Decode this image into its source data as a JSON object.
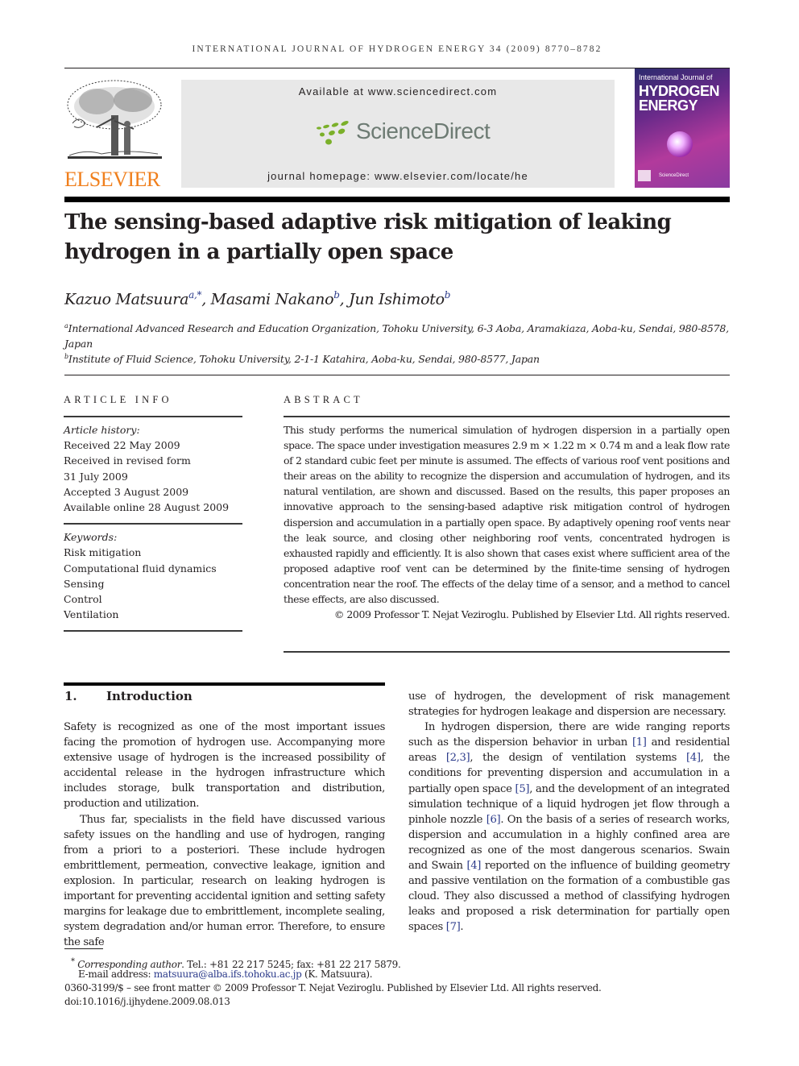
{
  "header": {
    "running_head": "INTERNATIONAL JOURNAL OF HYDROGEN ENERGY 34 (2009) 8770–8782",
    "publisher_word": "ELSEVIER",
    "available_at": "Available at www.sciencedirect.com",
    "sciencedirect_logo": "ScienceDirect",
    "journal_homepage": "journal homepage: www.elsevier.com/locate/he",
    "cover": {
      "line1": "International Journal of",
      "line2": "HYDROGEN",
      "line3": "ENERGY",
      "footer": "ScienceDirect"
    },
    "colors": {
      "elsevier_orange": "#f07f1c",
      "sd_green": "#7bb02a",
      "sd_gray": "#6d7b73",
      "link_blue": "#2b3a8a"
    }
  },
  "article": {
    "title_line1": "The sensing-based adaptive risk mitigation of leaking",
    "title_line2": "hydrogen in a partially open space",
    "authors": [
      {
        "name": "Kazuo Matsuura",
        "sup": "a,*"
      },
      {
        "name": "Masami Nakano",
        "sup": "b"
      },
      {
        "name": "Jun Ishimoto",
        "sup": "b"
      }
    ],
    "sep": ", ",
    "affiliations": [
      {
        "mark": "a",
        "text": "International Advanced Research and Education Organization, Tohoku University, 6-3 Aoba, Aramakiaza, Aoba-ku, Sendai, 980-8578,",
        "text2": "Japan"
      },
      {
        "mark": "b",
        "text": "Institute of Fluid Science, Tohoku University, 2-1-1 Katahira, Aoba-ku, Sendai, 980-8577, Japan"
      }
    ]
  },
  "article_info": {
    "heading": "ARTICLE INFO",
    "history_label": "Article history:",
    "history": [
      "Received 22 May 2009",
      "Received in revised form",
      "31 July 2009",
      "Accepted 3 August 2009",
      "Available online 28 August 2009"
    ],
    "keywords_label": "Keywords:",
    "keywords": [
      "Risk mitigation",
      "Computational fluid dynamics",
      "Sensing",
      "Control",
      "Ventilation"
    ]
  },
  "abstract": {
    "heading": "ABSTRACT",
    "text": "This study performs the numerical simulation of hydrogen dispersion in a partially open space. The space under investigation measures 2.9 m × 1.22 m × 0.74 m and a leak flow rate of 2 standard cubic feet per minute is assumed. The effects of various roof vent positions and their areas on the ability to recognize the dispersion and accumulation of hydrogen, and its natural ventilation, are shown and discussed. Based on the results, this paper proposes an innovative approach to the sensing-based adaptive risk mitigation control of hydrogen dispersion and accumulation in a partially open space. By adaptively opening roof vents near the leak source, and closing other neighboring roof vents, concentrated hydrogen is exhausted rapidly and efficiently. It is also shown that cases exist where sufficient area of the proposed adaptive roof vent can be determined by the finite-time sensing of hydrogen concentration near the roof. The effects of the delay time of a sensor, and a method to cancel these effects, are also discussed.",
    "copyright": "© 2009 Professor T. Nejat Veziroglu. Published by Elsevier Ltd. All rights reserved."
  },
  "introduction": {
    "number": "1.",
    "title": "Introduction",
    "p1": "Safety is recognized as one of the most important issues facing the promotion of hydrogen use. Accompanying more extensive usage of hydrogen is the increased possibility of accidental release in the hydrogen infrastructure which includes storage, bulk transportation and distribution, production and utilization.",
    "p2": "Thus far, specialists in the field have discussed various safety issues on the handling and use of hydrogen, ranging from a priori to a posteriori. These include hydrogen embrittlement, permeation, convective leakage, ignition and explosion. In particular, research on leaking hydrogen is important for preventing accidental ignition and setting safety margins for leakage due to embrittlement, incomplete sealing, system degradation and/or human error. Therefore, to ensure the safe",
    "p2_cont": "use of hydrogen, the development of risk management strategies for hydrogen leakage and dispersion are necessary.",
    "p3": {
      "s1": "In hydrogen dispersion, there are wide ranging reports such as the dispersion behavior in urban ",
      "r1": "[1]",
      "s2": " and residential areas ",
      "r2": "[2,3]",
      "s3": ", the design of ventilation systems ",
      "r3": "[4]",
      "s4": ", the conditions for preventing dispersion and accumulation in a partially open space ",
      "r4": "[5]",
      "s5": ", and the development of an integrated simulation technique of a liquid hydrogen jet flow through a pinhole nozzle ",
      "r5": "[6]",
      "s6": ". On the basis of a series of research works, dispersion and accumulation in a highly confined area are recognized as one of the most dangerous scenarios. Swain and Swain ",
      "r6": "[4]",
      "s7": " reported on the influence of building geometry and passive ventilation on the formation of a combustible gas cloud. They also discussed a method of classifying hydrogen leaks and proposed a risk determination for partially open spaces ",
      "r7": "[7]",
      "s8": "."
    }
  },
  "footnotes": {
    "star": "*",
    "corr_label": "Corresponding author",
    "corr_text": ". Tel.: +81 22 217 5245; fax: +81 22 217 5879.",
    "email_label": "E-mail address: ",
    "email": "matsuura@alba.ifs.tohoku.ac.jp",
    "email_suffix": " (K. Matsuura).",
    "front_matter": "0360-3199/$ – see front matter © 2009 Professor T. Nejat Veziroglu. Published by Elsevier Ltd. All rights reserved.",
    "doi": "doi:10.1016/j.ijhydene.2009.08.013"
  }
}
